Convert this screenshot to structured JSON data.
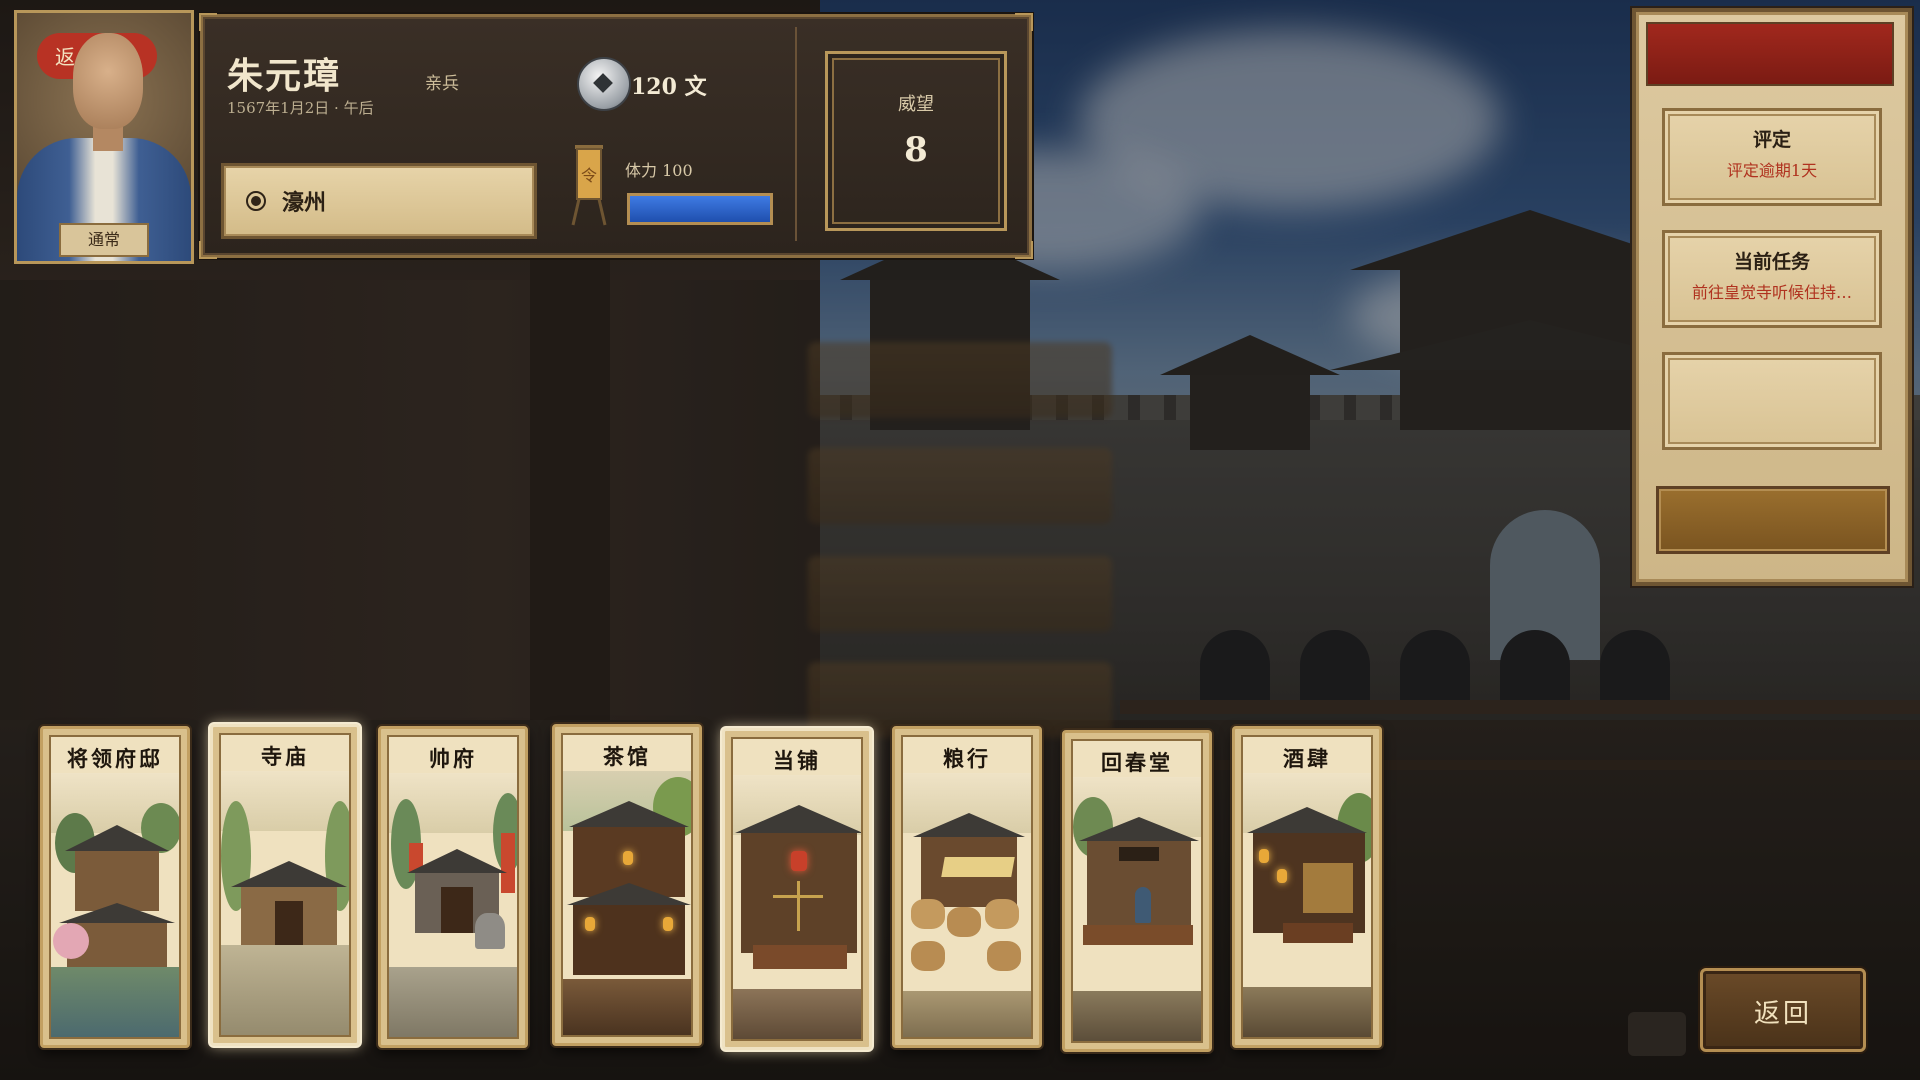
{
  "character": {
    "name": "朱元璋",
    "title": "亲兵",
    "date": "1567年1月2日 · 午后",
    "status": "通常",
    "portrait_overlay_text": "返",
    "money": "120 文",
    "location": "濠州",
    "stamina_label": "体力 100",
    "stamina": 100,
    "stamina_max": 100,
    "prestige_label": "威望",
    "prestige_value": "8"
  },
  "side_panel": {
    "cards": [
      {
        "title": "评定",
        "subtitle": "评定逾期1天"
      },
      {
        "title": "当前任务",
        "subtitle": "前往皇觉寺听候住持…"
      },
      {
        "title": "",
        "subtitle": ""
      }
    ]
  },
  "locations": [
    {
      "label": "将领府邸"
    },
    {
      "label": "寺庙"
    },
    {
      "label": "帅府"
    },
    {
      "label": "茶馆"
    },
    {
      "label": "当铺"
    },
    {
      "label": "粮行"
    },
    {
      "label": "回春堂"
    },
    {
      "label": "酒肆"
    }
  ],
  "return_button": "返回",
  "colors": {
    "accent_red": "#b0321f",
    "stamina_blue": "#2f62c8",
    "frame_gold": "#b8975a"
  },
  "icons": [
    "coin-icon",
    "banner-icon",
    "radio-icon"
  ]
}
